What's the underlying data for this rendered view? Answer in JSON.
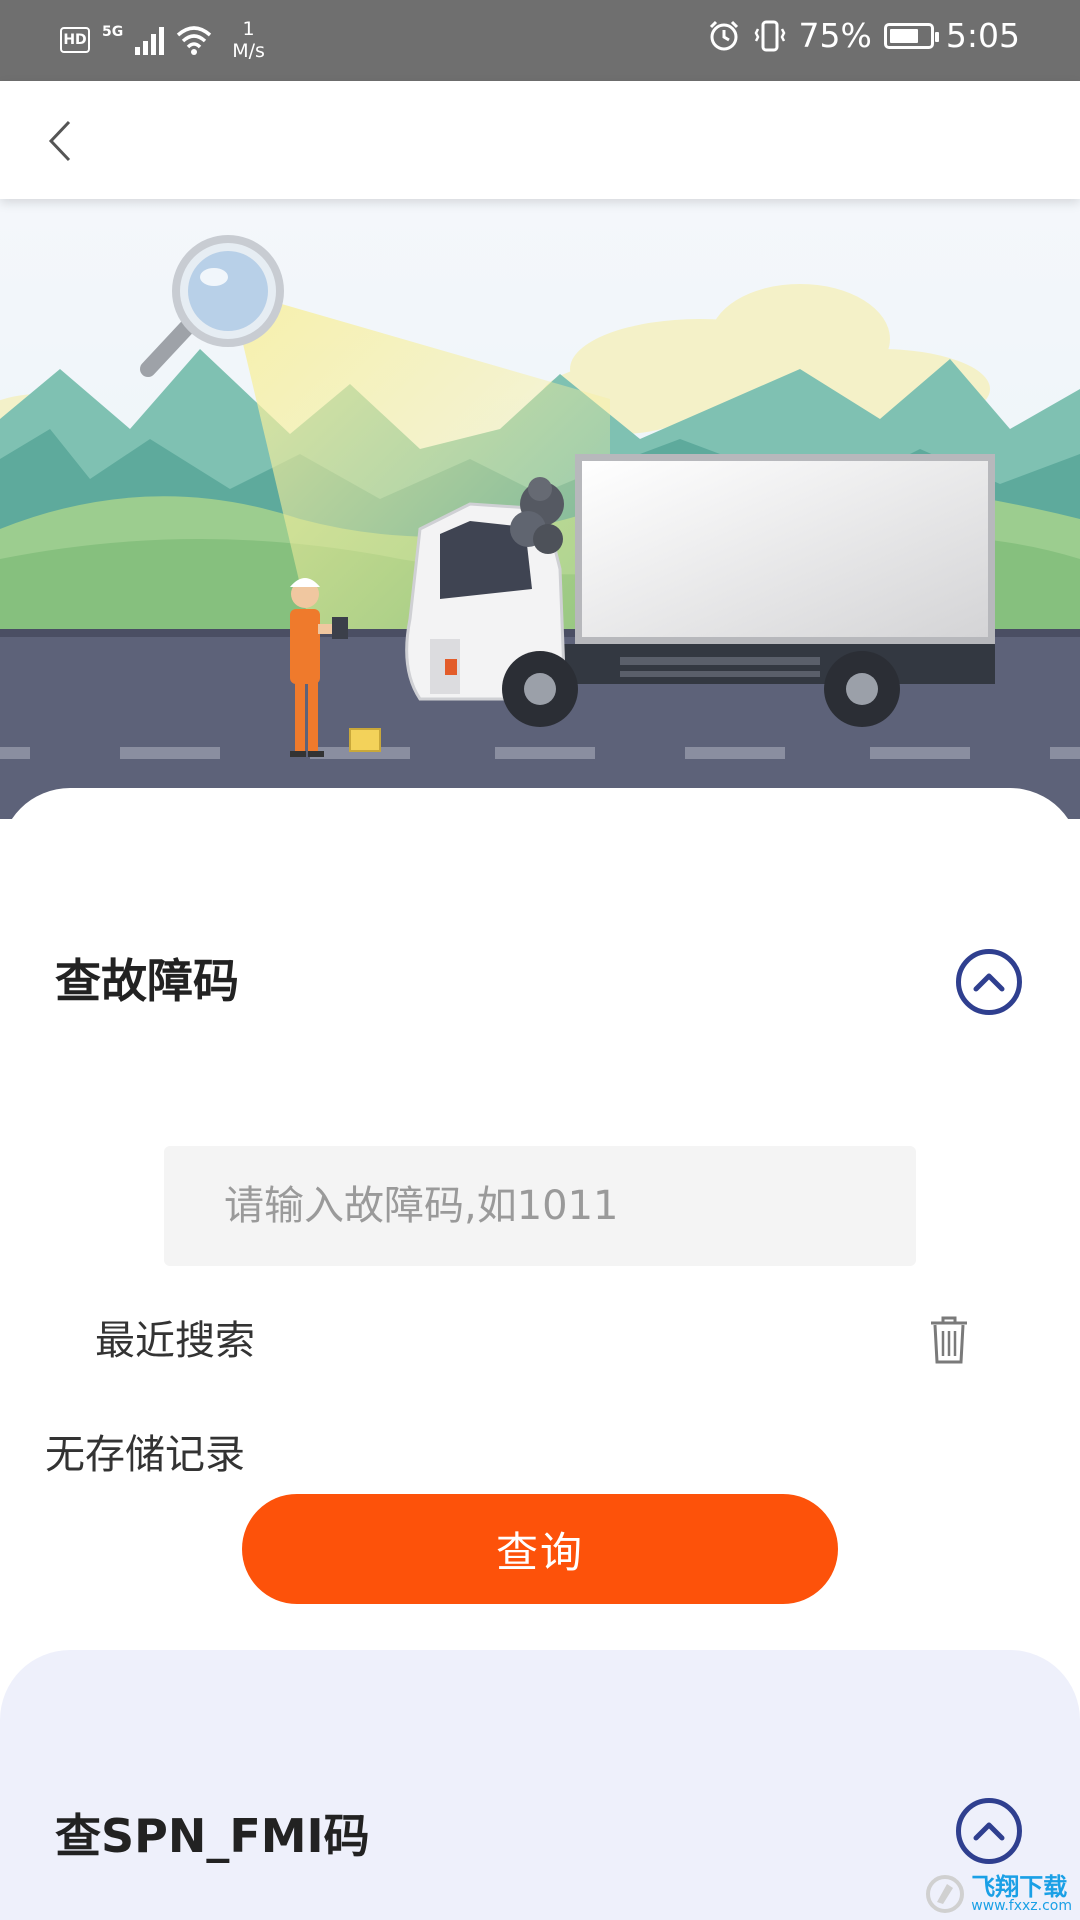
{
  "status_bar": {
    "hd": "HD",
    "network": "5G",
    "speed_value": "1",
    "speed_unit": "M/s",
    "battery": "75%",
    "battery_level": 0.75,
    "time": "5:05"
  },
  "fault_section": {
    "title": "查故障码",
    "search_placeholder": "请输入故障码,如1011",
    "search_value": "",
    "recent_label": "最近搜索",
    "empty_text": "无存储记录",
    "query_button": "查询"
  },
  "spn_section": {
    "title": "查SPN_FMI码"
  },
  "watermark": {
    "main": "飞翔下载",
    "sub": "www.fxxz.com"
  },
  "colors": {
    "accent": "#fd520a",
    "icon_blue": "#2f3f8f",
    "status_bar": "#6f6f6f",
    "spn_card": "#eef0fb"
  }
}
